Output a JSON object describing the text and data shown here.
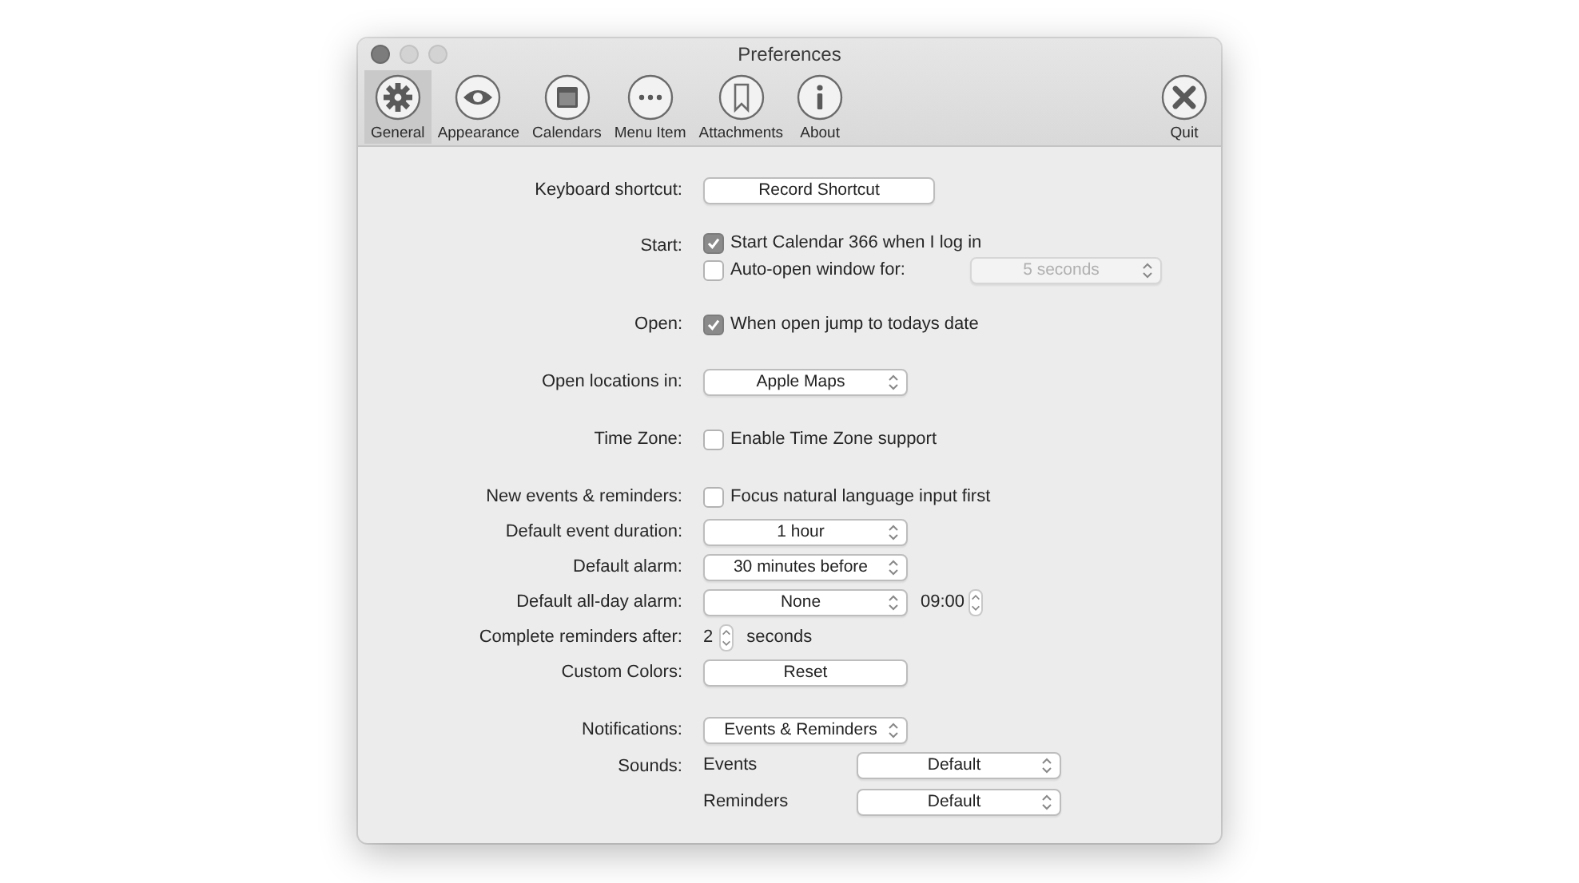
{
  "window": {
    "title": "Preferences"
  },
  "toolbar": [
    {
      "label": "General",
      "selected": true
    },
    {
      "label": "Appearance",
      "selected": false
    },
    {
      "label": "Calendars",
      "selected": false
    },
    {
      "label": "Menu Item",
      "selected": false
    },
    {
      "label": "Attachments",
      "selected": false
    },
    {
      "label": "About",
      "selected": false
    },
    {
      "label": "Quit",
      "selected": false
    }
  ],
  "sections": [
    {
      "rows": [
        {
          "label": "Keyboard shortcut:",
          "kind": "button",
          "button": "Record Shortcut"
        }
      ]
    },
    {
      "rows": [
        {
          "label": "Start:",
          "kind": "checks",
          "options": [
            {
              "text": "Start Calendar 366 when I log in",
              "checked": true
            },
            {
              "text": "Auto-open window for:",
              "checked": false,
              "popup": {
                "value": "5 seconds",
                "disabled": true
              }
            }
          ]
        }
      ]
    },
    {
      "rows": [
        {
          "label": "Open:",
          "kind": "checks",
          "options": [
            {
              "text": "When open jump to todays date",
              "checked": true
            }
          ]
        }
      ]
    },
    {
      "rows": [
        {
          "label": "Open locations in:",
          "kind": "popup",
          "value": "Apple Maps"
        }
      ]
    },
    {
      "rows": [
        {
          "label": "Time Zone:",
          "kind": "checks",
          "options": [
            {
              "text": "Enable Time Zone support",
              "checked": false
            }
          ]
        }
      ]
    },
    {
      "rows": [
        {
          "label": "New events & reminders:",
          "kind": "checks",
          "options": [
            {
              "text": "Focus natural language input first",
              "checked": false
            }
          ]
        },
        {
          "label": "Default event duration:",
          "kind": "popup",
          "value": "1 hour"
        },
        {
          "label": "Default alarm:",
          "kind": "popup",
          "value": "30 minutes before"
        },
        {
          "label": "Default all-day alarm:",
          "kind": "popup",
          "value": "None",
          "time": "09:00"
        },
        {
          "label": "Complete reminders after:",
          "kind": "stepper",
          "value": "2",
          "unit": "seconds"
        },
        {
          "label": "Custom Colors:",
          "kind": "button",
          "button": "Reset"
        }
      ]
    },
    {
      "rows": [
        {
          "label": "Notifications:",
          "kind": "popup",
          "value": "Events & Reminders"
        },
        {
          "label": "Sounds:",
          "kind": "sounds",
          "items": [
            {
              "name": "Events",
              "value": "Default"
            },
            {
              "name": "Reminders",
              "value": "Default"
            }
          ]
        }
      ]
    }
  ]
}
